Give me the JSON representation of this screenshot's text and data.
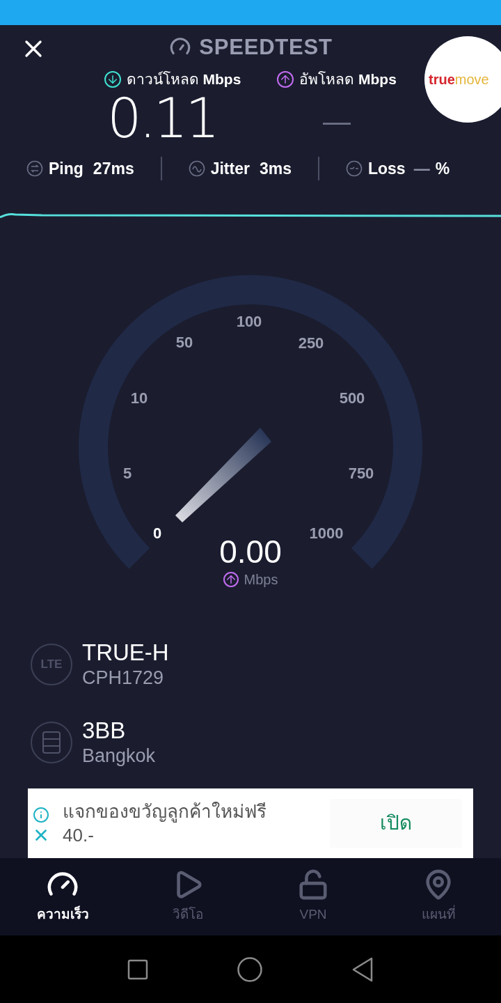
{
  "header": {
    "title": "SPEEDTEST",
    "logo": {
      "text_1": "true",
      "text_2": "move"
    }
  },
  "results": [
    {
      "kind": "download",
      "label": "ดาวน์โหลด",
      "unit": "Mbps",
      "value": "0.11"
    },
    {
      "kind": "upload",
      "label": "อัพโหลด",
      "unit": "Mbps",
      "value": "—"
    }
  ],
  "stats": [
    {
      "kind": "ping",
      "label": "Ping",
      "value": "27ms"
    },
    {
      "kind": "jitter",
      "label": "Jitter",
      "value": "3ms"
    },
    {
      "kind": "loss",
      "label": "Loss",
      "value": "—",
      "unit": "%"
    }
  ],
  "gauge": {
    "scale": [
      {
        "label": "0",
        "highlighted": true
      },
      {
        "label": "5",
        "highlighted": false
      },
      {
        "label": "10",
        "highlighted": false
      },
      {
        "label": "50",
        "highlighted": false
      },
      {
        "label": "100",
        "highlighted": false
      },
      {
        "label": "250",
        "highlighted": false
      },
      {
        "label": "500",
        "highlighted": false
      },
      {
        "label": "750",
        "highlighted": false
      },
      {
        "label": "1000",
        "highlighted": false
      }
    ],
    "reading": "0.00",
    "unit": "Mbps"
  },
  "connections": [
    {
      "kind": "lte",
      "icon_text": "LTE",
      "name": "TRUE-H",
      "detail": "CPH1729"
    },
    {
      "kind": "server",
      "name": "3BB",
      "detail": "Bangkok"
    }
  ],
  "ad": {
    "text_1": "แจกของขวัญลูกค้าใหม่ฟรี",
    "text_2": "40.-",
    "button": "เปิด"
  },
  "tabs": [
    {
      "kind": "speed",
      "label": "ความเร็ว",
      "selected": true
    },
    {
      "kind": "video",
      "label": "วิดีโอ",
      "selected": false
    },
    {
      "kind": "vpn",
      "label": "VPN",
      "selected": false
    },
    {
      "kind": "map",
      "label": "แผนที่",
      "selected": false
    }
  ]
}
